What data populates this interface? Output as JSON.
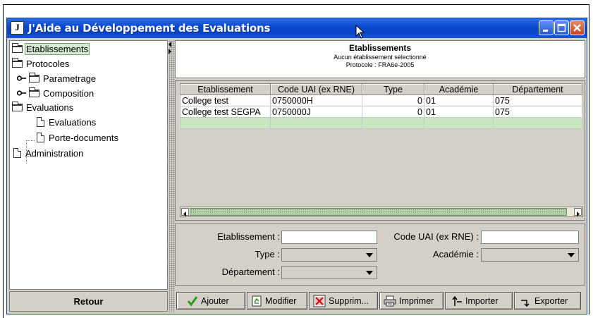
{
  "window": {
    "title": "J'Aide au Développement des Evaluations",
    "app_icon_text": "J",
    "controls": [
      "minimize",
      "maximize",
      "close"
    ]
  },
  "tree": {
    "items": [
      {
        "label": "Etablissements",
        "icon": "folder-icon",
        "selected": true
      },
      {
        "label": "Protocoles",
        "icon": "folder-icon"
      },
      {
        "label": "Parametrage",
        "icon": "folder-icon",
        "expander": "key-icon"
      },
      {
        "label": "Composition",
        "icon": "folder-icon",
        "expander": "key-icon"
      },
      {
        "label": "Evaluations",
        "icon": "folder-icon"
      },
      {
        "label": "Evaluations",
        "icon": "document-icon"
      },
      {
        "label": "Porte-documents",
        "icon": "document-icon"
      },
      {
        "label": "Administration",
        "icon": "document-icon"
      }
    ]
  },
  "retour_label": "Retour",
  "header": {
    "title": "Etablissements",
    "subtitle": "Aucun établissement sélectionné",
    "protocol": "Protocole : FRA6e-2005"
  },
  "table": {
    "columns": [
      "Etablissement",
      "Code UAI (ex RNE)",
      "Type",
      "Académie",
      "Département"
    ],
    "rows": [
      [
        "College test",
        "0750000H",
        "0",
        "01",
        "075"
      ],
      [
        "College test SEGPA",
        "0750000J",
        "0",
        "01",
        "075"
      ]
    ]
  },
  "form": {
    "etablissement_label": "Etablissement :",
    "etablissement_value": "",
    "code_label": "Code UAI (ex RNE) :",
    "code_value": "",
    "type_label": "Type :",
    "type_value": "",
    "academie_label": "Académie :",
    "academie_value": "",
    "departement_label": "Département :",
    "departement_value": ""
  },
  "toolbar": {
    "ajouter": "Ajouter",
    "modifier": "Modifier",
    "supprimer": "Supprim...",
    "imprimer": "Imprimer",
    "importer": "Importer",
    "exporter": "Exporter"
  },
  "colors": {
    "titlebar": "#0a4ad0",
    "selection": "#d6ebd2",
    "new_row": "#c8e6c0",
    "ajouter_check": "#2e9a1e"
  }
}
